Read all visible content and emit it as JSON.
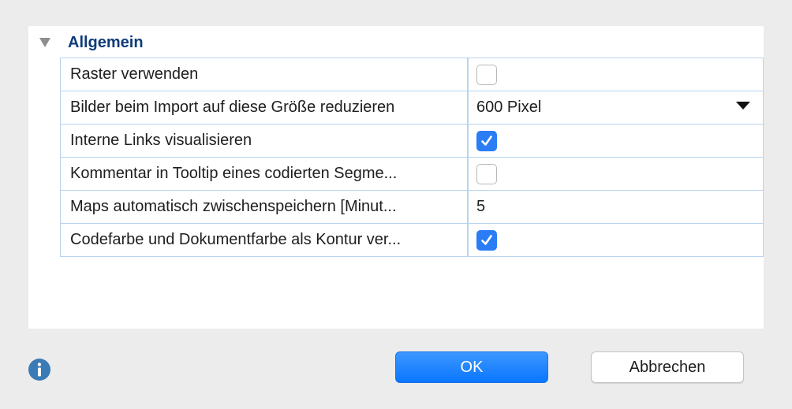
{
  "section": {
    "title": "Allgemein"
  },
  "rows": [
    {
      "label": "Raster verwenden",
      "type": "checkbox",
      "checked": false
    },
    {
      "label": "Bilder beim Import auf diese Größe reduzieren",
      "type": "select",
      "value": "600 Pixel"
    },
    {
      "label": "Interne Links visualisieren",
      "type": "checkbox",
      "checked": true
    },
    {
      "label": "Kommentar in Tooltip eines codierten Segme...",
      "type": "checkbox",
      "checked": false
    },
    {
      "label": "Maps automatisch zwischenspeichern [Minut...",
      "type": "text",
      "value": "5"
    },
    {
      "label": "Codefarbe und Dokumentfarbe als Kontur ver...",
      "type": "checkbox",
      "checked": true
    }
  ],
  "buttons": {
    "ok": "OK",
    "cancel": "Abbrechen"
  },
  "icons": {
    "info": "info-icon",
    "disclosure": "disclosure-triangle-icon",
    "checkmark": "checkmark-icon",
    "dropdown": "dropdown-arrow-icon"
  },
  "colors": {
    "accent": "#2b7df5",
    "section_title": "#0f3c7a",
    "grid_line": "#b7d3ef",
    "info_icon": "#3a7ab5"
  }
}
